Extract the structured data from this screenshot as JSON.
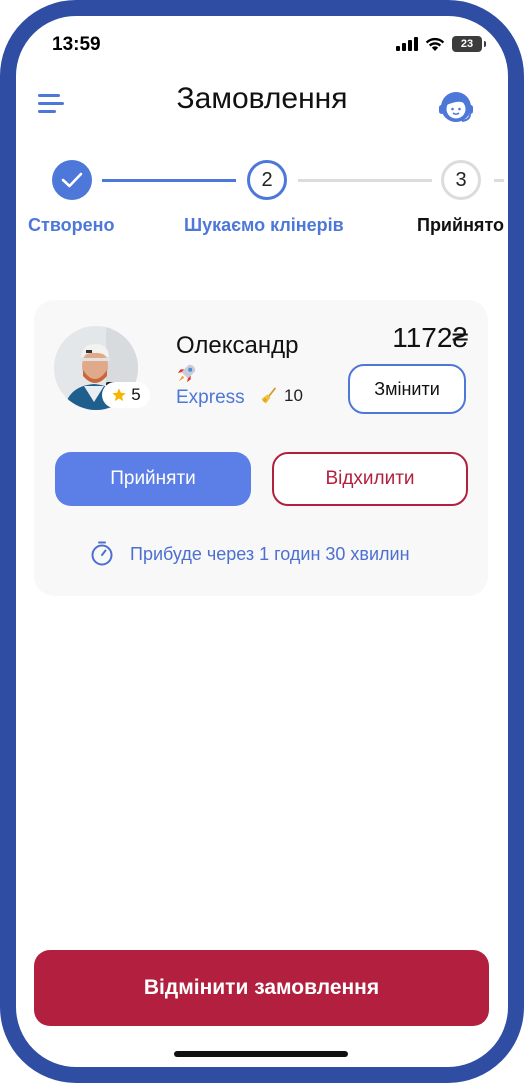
{
  "status_bar": {
    "time": "13:59",
    "battery": "23"
  },
  "header": {
    "title": "Замовлення"
  },
  "stepper": {
    "steps": [
      {
        "number": "",
        "label": "Створено",
        "state": "done"
      },
      {
        "number": "2",
        "label": "Шукаємо клінерів",
        "state": "active"
      },
      {
        "number": "3",
        "label": "Прийнято",
        "state": "idle"
      }
    ]
  },
  "offer": {
    "rating": "5",
    "name": "Олександр",
    "level": "Express",
    "count": "10",
    "price": "1172₴",
    "change_label": "Змінити",
    "accept_label": "Прийняти",
    "decline_label": "Відхилити",
    "eta": "Прибуде через 1 годин 30 хвилин"
  },
  "footer": {
    "cancel_label": "Відмінити замовлення"
  },
  "colors": {
    "accent": "#4d77d8",
    "danger": "#b3203f",
    "frame": "#2f4da3"
  },
  "icons": [
    "menu-icon",
    "support-agent-icon",
    "check-icon",
    "star-icon",
    "rocket-icon",
    "broom-icon",
    "stopwatch-icon",
    "wifi-icon",
    "signal-icon",
    "battery-icon"
  ]
}
